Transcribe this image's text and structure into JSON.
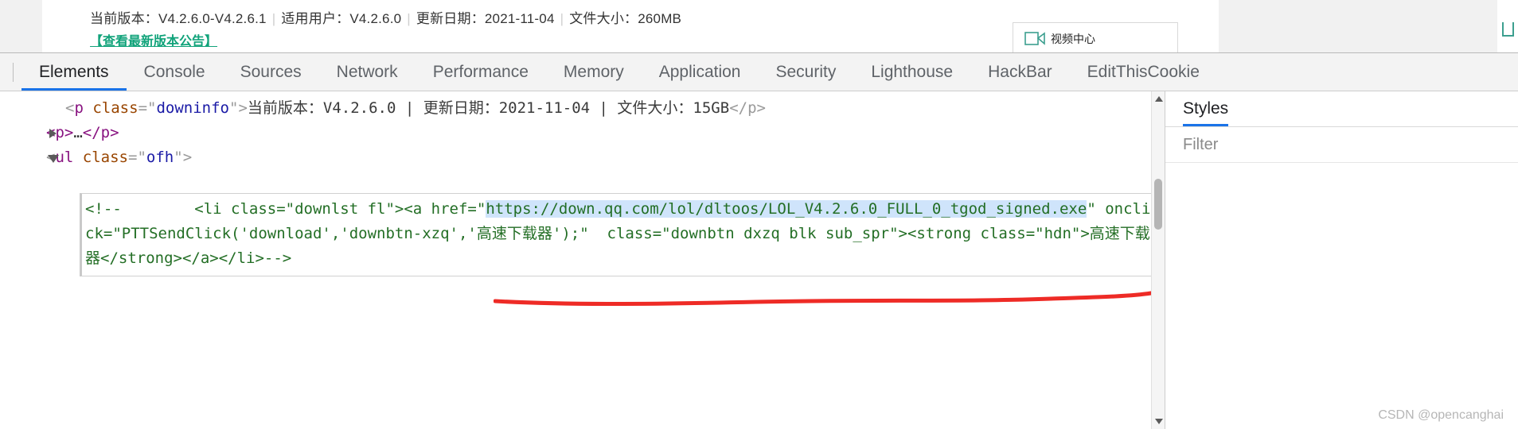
{
  "page": {
    "downinfo": {
      "label_version": "当前版本：",
      "value_version": "V4.2.6.0-V4.2.6.1",
      "label_users": "适用用户：",
      "value_users": "V4.2.6.0",
      "label_date": "更新日期：",
      "value_date": "2021-11-04",
      "label_size": "文件大小：",
      "value_size": "260MB",
      "separator": "|"
    },
    "notice_link": "【查看最新版本公告】",
    "notice_link_color": "#11a37a",
    "side_panel_label": "视频中心",
    "side_panel_icon": "video-play-icon"
  },
  "devtools": {
    "tabs": [
      {
        "label": "Elements",
        "active": true
      },
      {
        "label": "Console",
        "active": false
      },
      {
        "label": "Sources",
        "active": false
      },
      {
        "label": "Network",
        "active": false
      },
      {
        "label": "Performance",
        "active": false
      },
      {
        "label": "Memory",
        "active": false
      },
      {
        "label": "Application",
        "active": false
      },
      {
        "label": "Security",
        "active": false
      },
      {
        "label": "Lighthouse",
        "active": false
      },
      {
        "label": "HackBar",
        "active": false
      },
      {
        "label": "EditThisCookie",
        "active": false
      }
    ],
    "accent_color": "#1a73e8",
    "tree": {
      "line1": {
        "open_lt": "<",
        "tag": "p",
        "space": " ",
        "attr_name": "class",
        "eq": "=",
        "quote": "\"",
        "attr_value": "downinfo",
        "gt": ">",
        "text": "当前版本：V4.2.6.0 | 更新日期：2021-11-04 | 文件大小：15GB",
        "close": "</p>"
      },
      "line2": {
        "open": "<p>",
        "ellipsis": "…",
        "close": "</p>",
        "twisty": "collapsed"
      },
      "line3": {
        "open_lt": "<",
        "tag": "ul",
        "space": " ",
        "attr_name": "class",
        "eq": "=",
        "quote": "\"",
        "attr_value": "ofh",
        "gt": ">",
        "twisty": "expanded"
      },
      "comment": {
        "part1": "<!--        <li class=\"downlst fl\"><a href=\"",
        "url": "https://down.qq.com/lol/dltoos/LOL_V4.2.6.0_FULL_0_tgod_signed.exe",
        "part2": "\" onclick=\"PTTSendClick('download','downbtn-xzq','高速下载器');\"  class=\"downbtn dxzq blk sub_spr\"><strong class=\"hdn\">高速下载器</strong></a></li>-->",
        "url_highlight_color": "#cfe4fb",
        "text_color": "#236e25"
      },
      "annotation": {
        "type": "red-underline-scribble",
        "color": "#ee2b26"
      }
    },
    "styles_panel": {
      "tab_label": "Styles",
      "filter_placeholder": "Filter"
    }
  },
  "watermark": "CSDN @opencanghai"
}
